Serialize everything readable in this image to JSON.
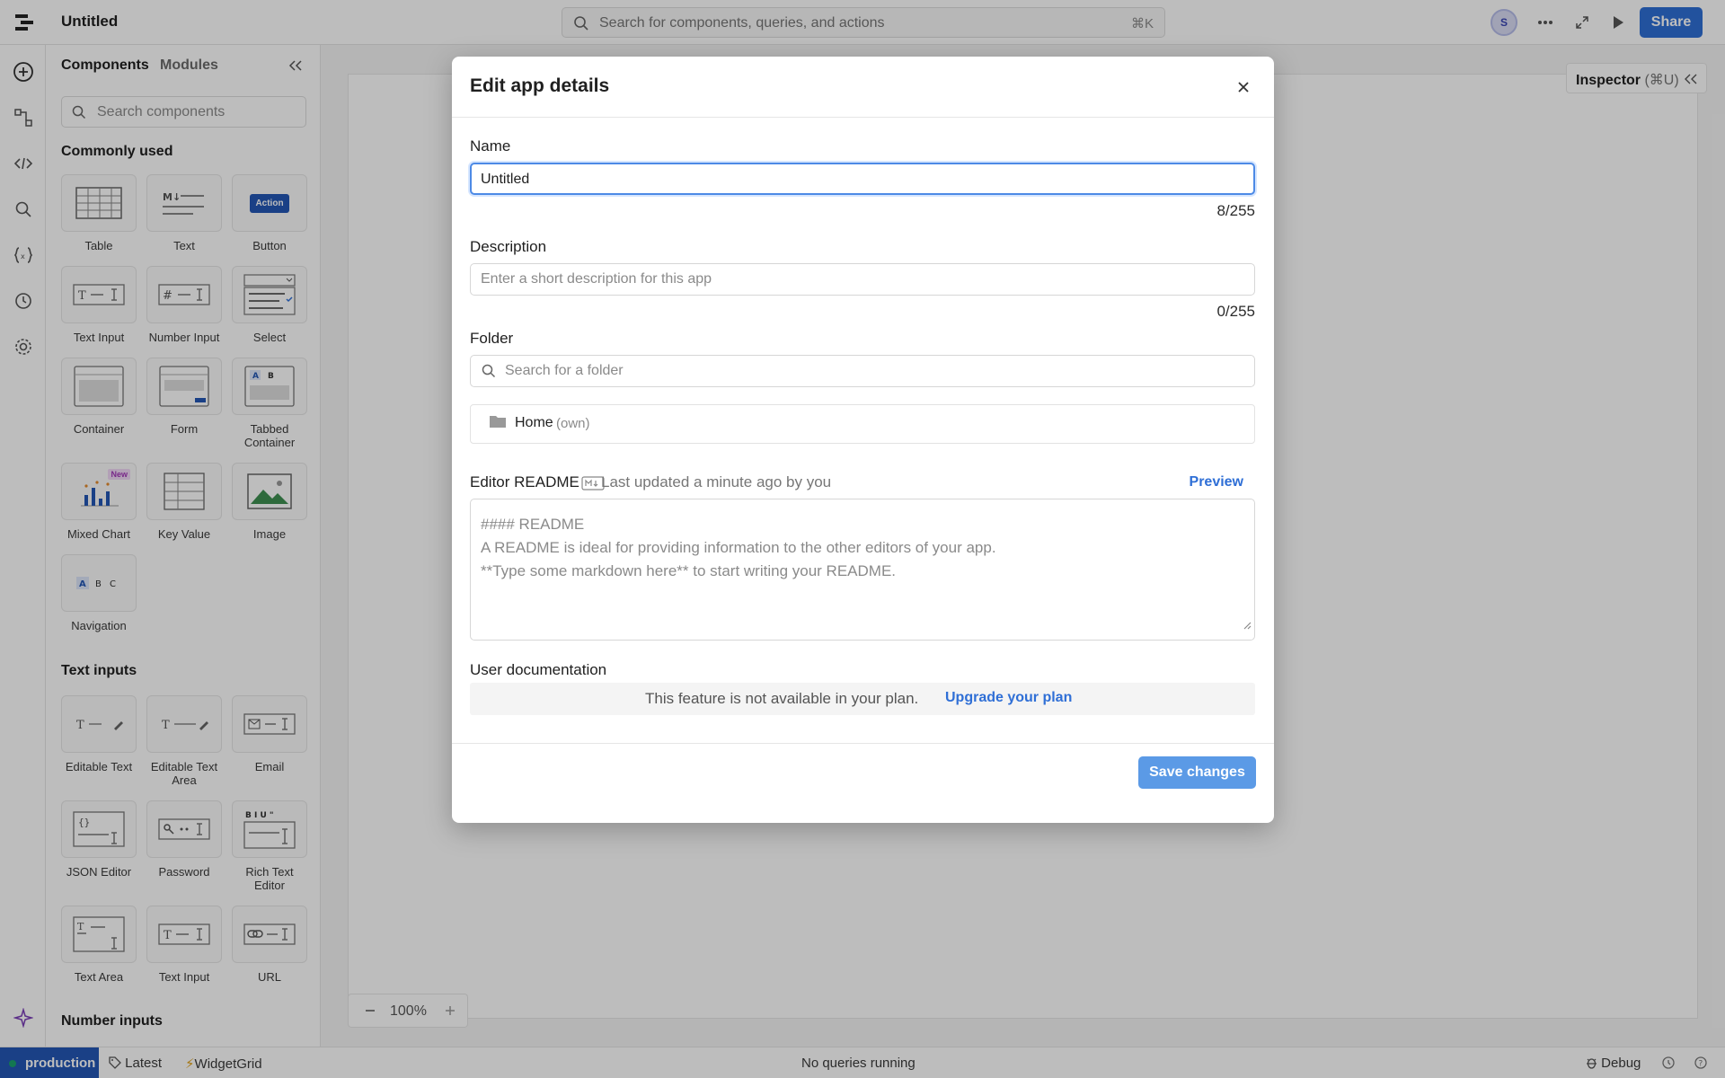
{
  "app": {
    "title": "Untitled"
  },
  "search": {
    "placeholder": "Search for components, queries, and actions",
    "shortcut": "⌘K"
  },
  "user": {
    "initial": "S"
  },
  "toolbar": {
    "share_label": "Share"
  },
  "panel": {
    "tabs": [
      "Components",
      "Modules"
    ],
    "search_placeholder": "Search components",
    "section_common": "Commonly used",
    "common": [
      {
        "label": "Table"
      },
      {
        "label": "Text"
      },
      {
        "label": "Button",
        "badge": "Action"
      },
      {
        "label": "Text Input"
      },
      {
        "label": "Number Input"
      },
      {
        "label": "Select"
      },
      {
        "label": "Container"
      },
      {
        "label": "Form"
      },
      {
        "label": "Tabbed Container"
      },
      {
        "label": "Mixed Chart",
        "badge": "New"
      },
      {
        "label": "Key Value"
      },
      {
        "label": "Image"
      },
      {
        "label": "Navigation"
      }
    ],
    "section_text": "Text inputs",
    "text_inputs": [
      {
        "label": "Editable Text"
      },
      {
        "label": "Editable Text Area"
      },
      {
        "label": "Email"
      },
      {
        "label": "JSON Editor"
      },
      {
        "label": "Password"
      },
      {
        "label": "Rich Text Editor"
      },
      {
        "label": "Text Area"
      },
      {
        "label": "Text Input"
      },
      {
        "label": "URL"
      }
    ],
    "section_number": "Number inputs"
  },
  "inspector": {
    "title": "Inspector",
    "shortcut": "(⌘U)"
  },
  "zoom": {
    "value": "100%"
  },
  "status": {
    "env": "production",
    "version": "Latest",
    "branch": "WidgetGrid",
    "queries": "No queries running",
    "debug": "Debug"
  },
  "modal": {
    "title": "Edit app details",
    "name_label": "Name",
    "name_value": "Untitled",
    "name_counter": "8/255",
    "description_label": "Description",
    "description_placeholder": "Enter a short description for this app",
    "description_counter": "0/255",
    "folder_label": "Folder",
    "folder_placeholder": "Search for a folder",
    "folder_item": "Home",
    "folder_owner": "(own)",
    "readme_label": "Editor README",
    "readme_meta": "Last updated a minute ago by you",
    "preview_label": "Preview",
    "readme_placeholder": [
      "#### README",
      "A README is ideal for providing information to the other editors of your app.",
      "**Type some markdown here** to start writing your README."
    ],
    "user_doc_label": "User documentation",
    "plan_message": "This feature is not available in your plan.",
    "upgrade_label": "Upgrade your plan",
    "save_label": "Save changes"
  },
  "colors": {
    "accent": "#2f6fd6",
    "env": "#2457b5",
    "save": "#5b9ae6",
    "focus": "#4d8ae6"
  }
}
